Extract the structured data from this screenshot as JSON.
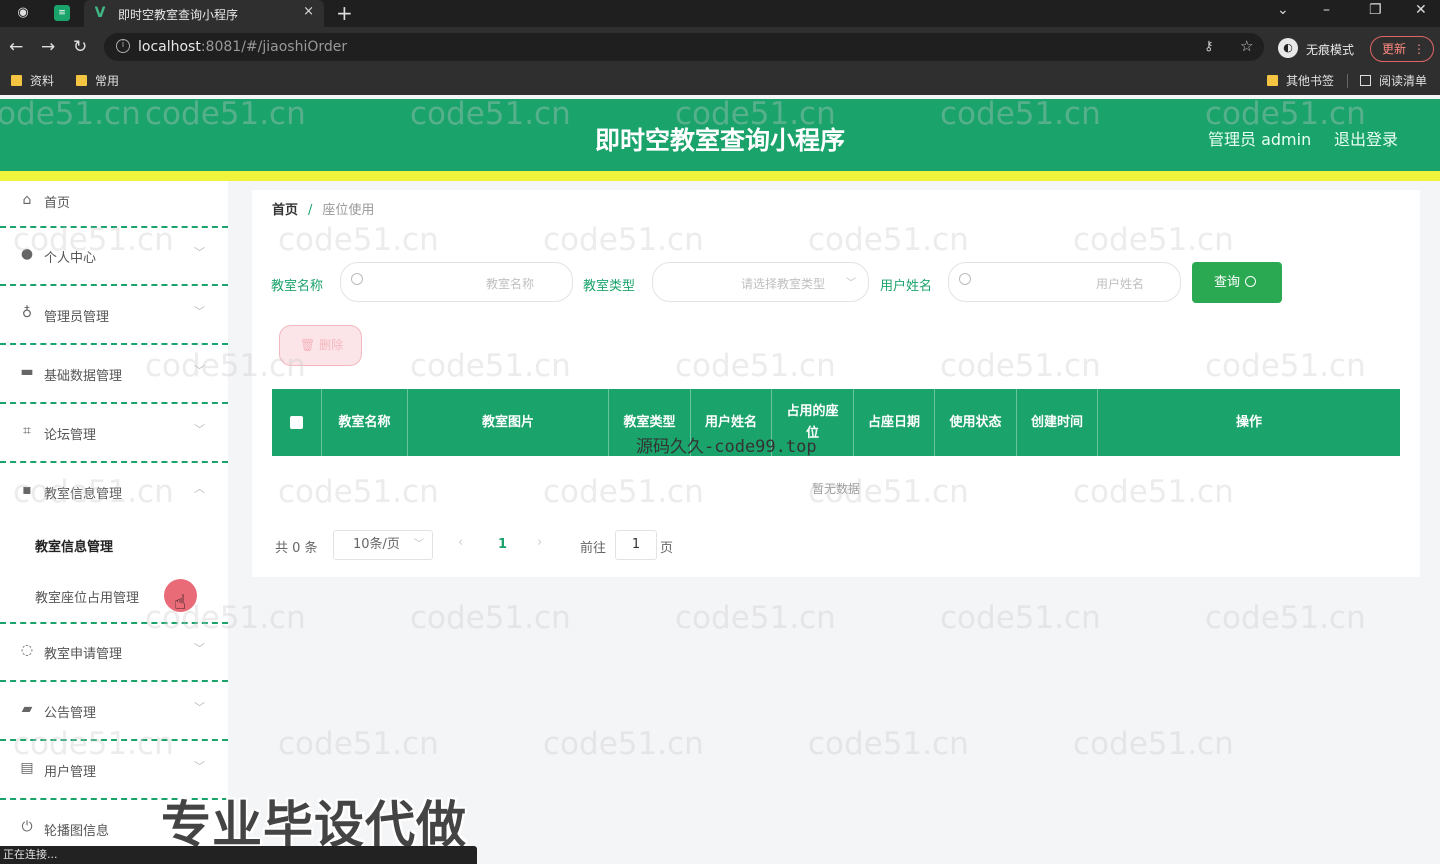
{
  "browser": {
    "tab_title": "即时空教室查询小程序",
    "tab_close": "×",
    "new_tab": "+",
    "url_host": "localhost",
    "url_path": ":8081/#/jiaoshiOrder",
    "incognito_label": "无痕模式",
    "update_label": "更新",
    "bookmarks": [
      "资料",
      "常用"
    ],
    "bookmarks_right": [
      "其他书签",
      "阅读清单"
    ],
    "status_text": "正在连接..."
  },
  "header": {
    "title": "即时空教室查询小程序",
    "user": "管理员 admin",
    "logout": "退出登录"
  },
  "sidebar": {
    "items": [
      {
        "label": "首页",
        "icon": "home-icon"
      },
      {
        "label": "个人中心",
        "icon": "user-icon"
      },
      {
        "label": "管理员管理",
        "icon": "mic-icon"
      },
      {
        "label": "基础数据管理",
        "icon": "box-icon"
      },
      {
        "label": "论坛管理",
        "icon": "crop-icon"
      },
      {
        "label": "教室信息管理",
        "icon": "chat-icon"
      },
      {
        "label": "教室申请管理",
        "icon": "globe-icon"
      },
      {
        "label": "公告管理",
        "icon": "ticket-icon"
      },
      {
        "label": "用户管理",
        "icon": "printer-icon"
      },
      {
        "label": "轮播图信息",
        "icon": "power-icon"
      }
    ],
    "subitems": [
      "教室信息管理",
      "教室座位占用管理"
    ]
  },
  "breadcrumb": {
    "home": "首页",
    "separator": "/",
    "current": "座位使用"
  },
  "filters": {
    "classroom_name_label": "教室名称",
    "classroom_name_placeholder": "教室名称",
    "classroom_type_label": "教室类型",
    "classroom_type_placeholder": "请选择教室类型",
    "user_name_label": "用户姓名",
    "user_name_placeholder": "用户姓名",
    "query_label": "查询"
  },
  "actions": {
    "delete_label": "删除"
  },
  "table": {
    "columns": [
      "教室名称",
      "教室图片",
      "教室类型",
      "用户姓名",
      "占用的座位",
      "占座日期",
      "使用状态",
      "创建时间",
      "操作"
    ],
    "empty_text": "暂无数据"
  },
  "pagination": {
    "total": "共 0 条",
    "page_size": "10条/页",
    "prev": "‹",
    "current_page": "1",
    "next": "›",
    "goto_label": "前往",
    "goto_value": "1",
    "page_suffix": "页"
  },
  "overlay": {
    "watermark": "code51.cn",
    "center_watermark": "源码久久-code99.top",
    "promo_text": "专业毕设代做"
  }
}
